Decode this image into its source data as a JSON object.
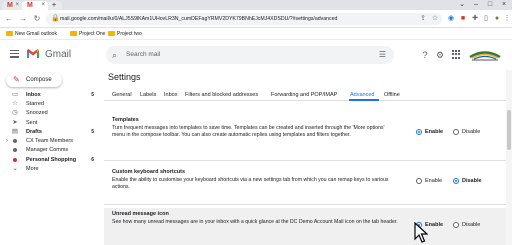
{
  "browser": {
    "url": "mail.google.com/mail/u/0/#settings/advanced",
    "omnibox_url": "mail.google.com/mail/u/0/ALJ5S9lKAm1UHovLR3N_cumDEFagYRMV2DYK79BNhEJcMJ4XDSDU/?#settings/advanced",
    "bookmarks": [
      "New Gmail outlook",
      "Project One",
      "Project two"
    ]
  },
  "header": {
    "app_name": "Gmail",
    "search_placeholder": "Search mail"
  },
  "sidebar": {
    "compose_label": "Compose",
    "items": [
      {
        "label": "Inbox",
        "count": "5",
        "icon": "inbox-icon",
        "bold": true
      },
      {
        "label": "Starred",
        "count": "",
        "icon": "star-icon",
        "bold": false
      },
      {
        "label": "Snoozed",
        "count": "",
        "icon": "clock-icon",
        "bold": false
      },
      {
        "label": "Sent",
        "count": "",
        "icon": "send-icon",
        "bold": false
      },
      {
        "label": "Drafts",
        "count": "5",
        "icon": "draft-icon",
        "bold": true
      },
      {
        "label": "CX Team Members",
        "count": "",
        "icon": "label-dot",
        "bold": false,
        "color": "#666666"
      },
      {
        "label": "Manager Comms",
        "count": "",
        "icon": "label-dot",
        "bold": false,
        "color": "#666666"
      },
      {
        "label": "Personal Shopping",
        "count": "6",
        "icon": "label-dot",
        "bold": true,
        "color": "#d93025"
      },
      {
        "label": "More",
        "count": "",
        "icon": "chevron-down-icon",
        "bold": false
      }
    ]
  },
  "settings": {
    "title": "Settings",
    "tabs": [
      "General",
      "Labels",
      "Inbox",
      "Filters and blocked addresses",
      "Forwarding and POP/IMAP",
      "Advanced",
      "Offline"
    ],
    "active_tab": "Advanced",
    "rows": [
      {
        "title": "Templates",
        "desc": "Turn frequent messages into templates to save time. Templates can be created and inserted through the 'More options' menu in the compose toolbar. You can also create automatic replies using templates and filters together.",
        "enable_label": "Enable",
        "disable_label": "Disable",
        "selected": "Enable"
      },
      {
        "title": "Custom keyboard shortcuts",
        "desc": "Enable the ability to customise your keyboard shortcuts via a new settings tab from which you can remap keys to various actions.",
        "enable_label": "Enable",
        "disable_label": "Disable",
        "selected": "Disable"
      },
      {
        "title": "Unread message icon",
        "desc": "See how many unread messages are in your inbox with a quick glance at the DC Demo Account Mail icon on the tab header.",
        "enable_label": "Enable",
        "disable_label": "Disable",
        "selected": "Enable"
      }
    ]
  },
  "colors": {
    "accent": "#1a73e8",
    "compose_icon": "#d93025"
  }
}
